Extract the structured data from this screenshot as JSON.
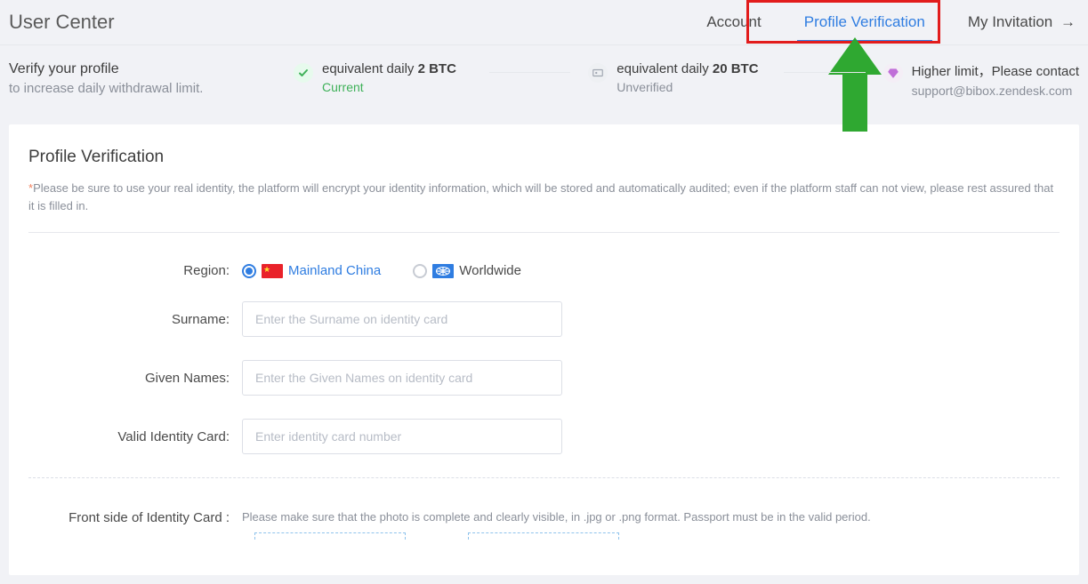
{
  "header": {
    "title": "User Center",
    "tabs": {
      "account": "Account",
      "profile_verification": "Profile Verification",
      "my_invitation": "My Invitation",
      "arrow": "→"
    }
  },
  "lead": {
    "line1": "Verify your profile",
    "line2": "to increase daily withdrawal limit."
  },
  "tiers": {
    "tier1_prefix": "equivalent daily ",
    "tier1_value": "2 BTC",
    "tier1_status": "Current",
    "tier2_prefix": "equivalent daily ",
    "tier2_value": "20 BTC",
    "tier2_status": "Unverified",
    "tier3_line1": "Higher limit，Please contact",
    "tier3_line2": "support@bibox.zendesk.com"
  },
  "panel": {
    "heading": "Profile Verification",
    "notice_star": "*",
    "notice": "Please be sure to use your real identity, the platform will encrypt your identity information, which will be stored and automatically audited; even if the platform staff can not view, please rest assured that it is filled in."
  },
  "form": {
    "region_label": "Region:",
    "region_mainland": "Mainland China",
    "region_worldwide": "Worldwide",
    "surname_label": "Surname:",
    "surname_placeholder": "Enter the Surname on identity card",
    "given_label": "Given Names:",
    "given_placeholder": "Enter the Given Names on identity card",
    "idcard_label": "Valid Identity Card:",
    "idcard_placeholder": "Enter identity card number",
    "front_label": "Front side of Identity Card :",
    "front_hint": "Please make sure that the photo is complete and clearly visible, in .jpg or .png format. Passport must be in the valid period."
  }
}
